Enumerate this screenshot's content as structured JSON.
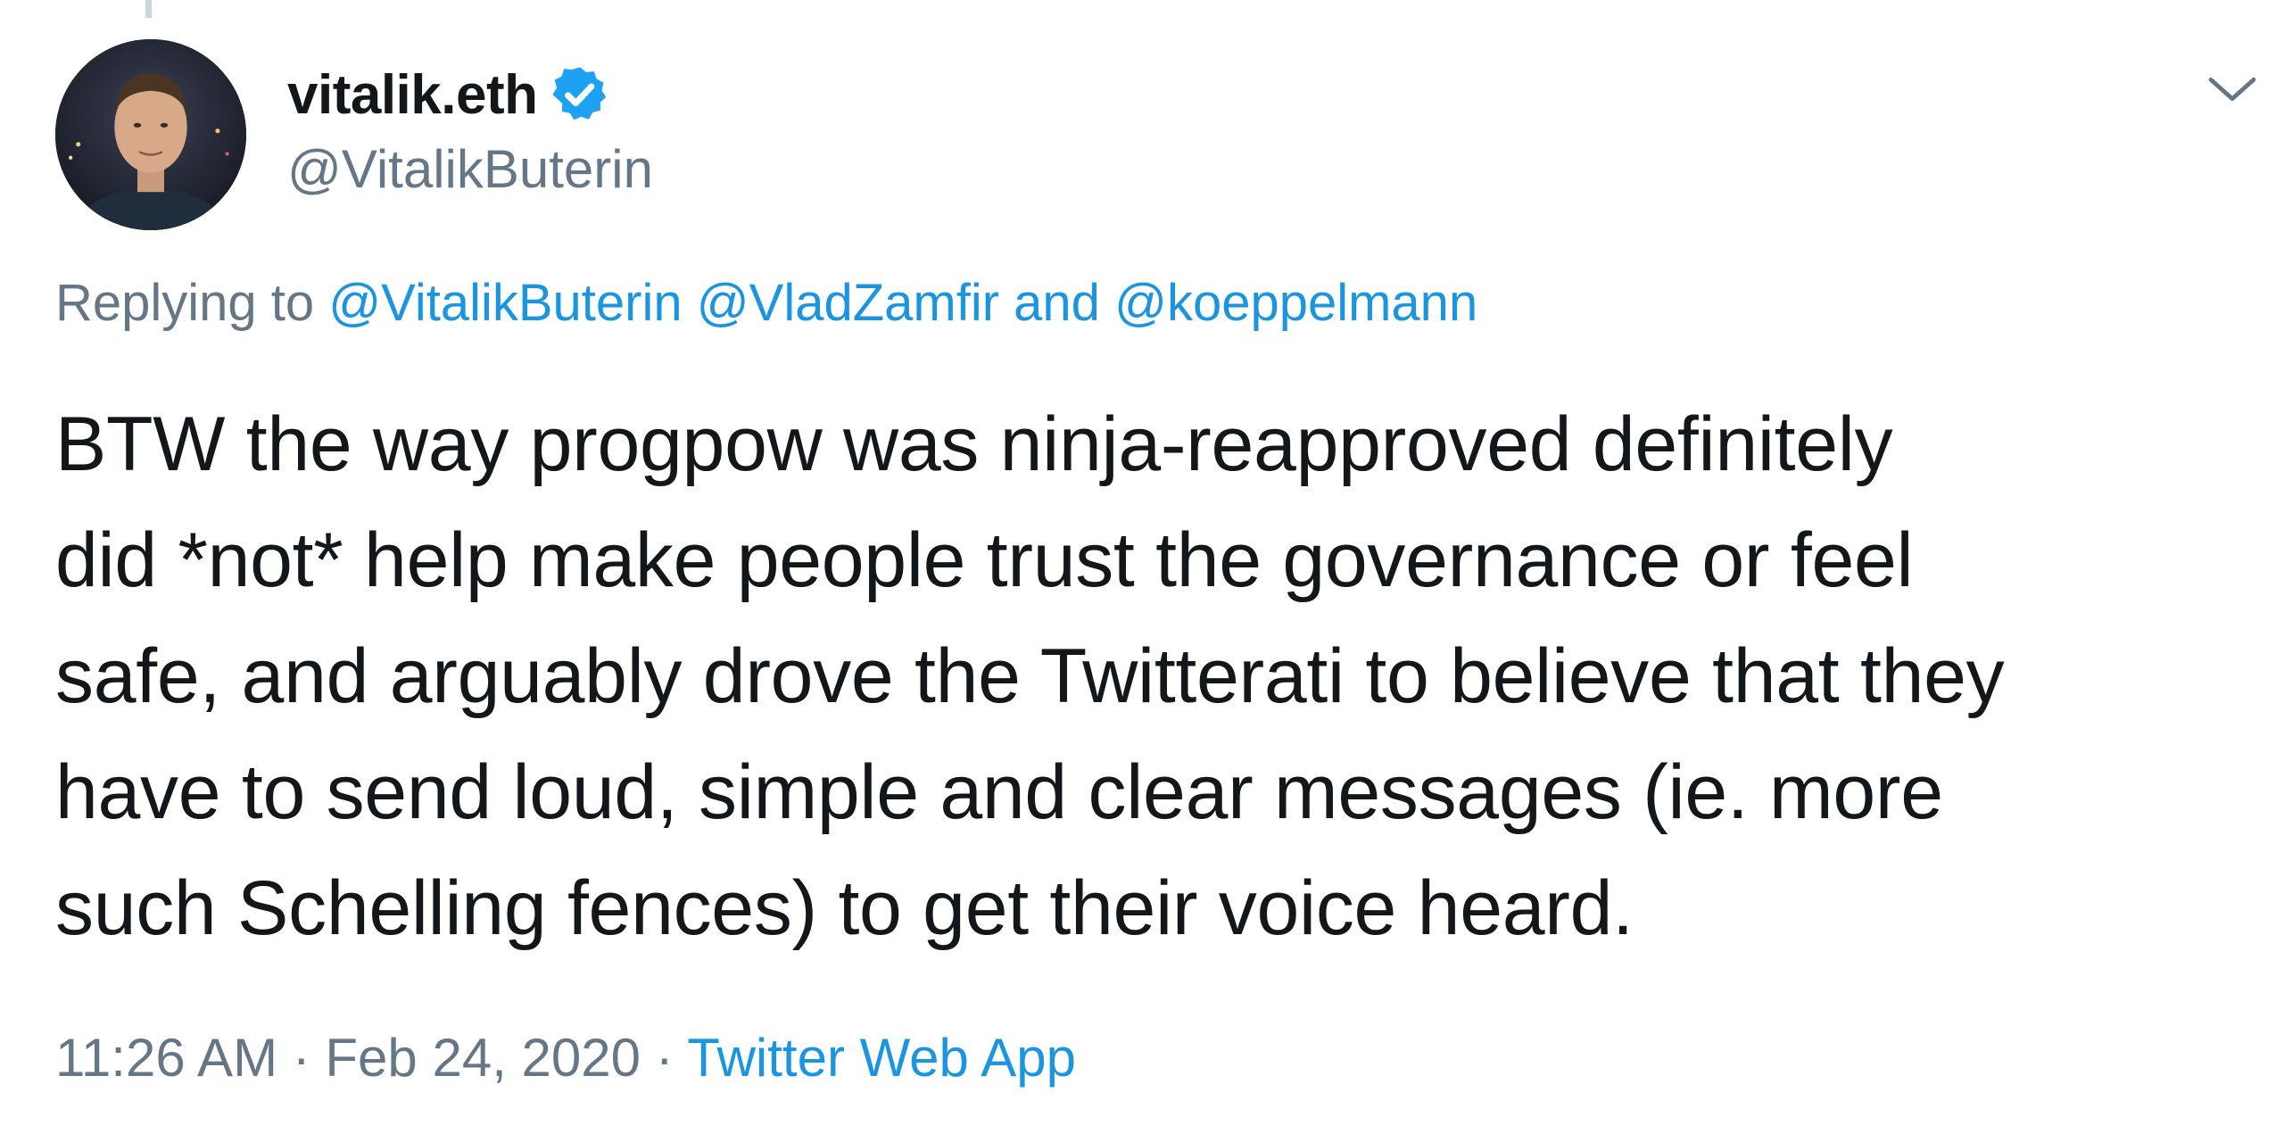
{
  "author": {
    "display_name": "vitalik.eth",
    "handle": "@VitalikButerin",
    "verified": true,
    "avatar_icon": "profile-photo"
  },
  "reply": {
    "prefix": "Replying to",
    "mentions": [
      "@VitalikButerin",
      "@VladZamfir"
    ],
    "conjunction": "and",
    "last_mention": "@koeppelmann"
  },
  "tweet": {
    "lines": [
      "BTW the way progpow was ninja-reapproved definitely",
      "did *not* help make people trust the governance or feel",
      "safe, and arguably drove the Twitterati to believe that they",
      "have to send loud, simple and clear messages (ie. more",
      "such Schelling fences) to get their voice heard."
    ]
  },
  "meta": {
    "time": "11:26 AM",
    "separator": "·",
    "date": "Feb 24, 2020",
    "source": "Twitter Web App"
  },
  "colors": {
    "text_primary": "#14171a",
    "text_secondary": "#657786",
    "link": "#1b95e0",
    "verified": "#1da1f2"
  },
  "icons": {
    "verified": "verified-badge-icon",
    "menu": "chevron-down-icon"
  }
}
